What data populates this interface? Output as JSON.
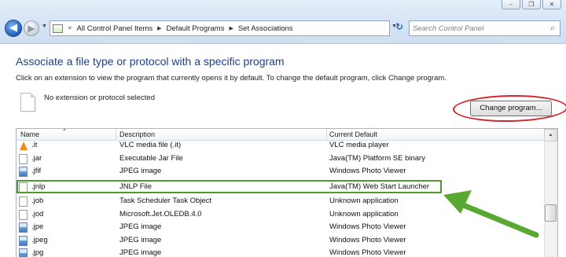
{
  "window": {
    "buttons": [
      "–",
      "❐",
      "✕"
    ]
  },
  "nav": {
    "back_glyph": "◀",
    "forward_glyph": "▶",
    "dropdown_glyph": "▼",
    "address_separator": "«",
    "breadcrumbs": [
      "All Control Panel Items",
      "Default Programs",
      "Set Associations"
    ],
    "crumb_separator": "▶",
    "refresh_glyph": "↻",
    "search_placeholder": "Search Control Panel"
  },
  "content": {
    "title": "Associate a file type or protocol with a specific program",
    "instructions": "Click on an extension to view the program that currently opens it by default. To change the default program, click Change program.",
    "selected_text": "No extension or protocol selected",
    "change_button": "Change program..."
  },
  "list": {
    "columns": [
      "Name",
      "Description",
      "Current Default"
    ],
    "rows": [
      {
        "name": ".it",
        "description": "VLC media file (.it)",
        "default": "VLC media player",
        "icon": "vlc-file-icon"
      },
      {
        "name": ".jar",
        "description": "Executable Jar File",
        "default": "Java(TM) Platform SE binary",
        "icon": "jar-file-icon"
      },
      {
        "name": ".jfif",
        "description": "JPEG image",
        "default": "Windows Photo Viewer",
        "icon": "image-file-icon"
      },
      {
        "name": ".jnlp",
        "description": "JNLP File",
        "default": "Java(TM) Web Start Launcher",
        "icon": "generic-file-icon"
      },
      {
        "name": ".job",
        "description": "Task Scheduler Task Object",
        "default": "Unknown application",
        "icon": "generic-file-icon"
      },
      {
        "name": ".jod",
        "description": "Microsoft.Jet.OLEDB.4.0",
        "default": "Unknown application",
        "icon": "generic-file-icon"
      },
      {
        "name": ".jpe",
        "description": "JPEG image",
        "default": "Windows Photo Viewer",
        "icon": "image-file-icon"
      },
      {
        "name": ".jpeg",
        "description": "JPEG image",
        "default": "Windows Photo Viewer",
        "icon": "image-file-icon"
      },
      {
        "name": ".jpg",
        "description": "JPEG image",
        "default": "Windows Photo Viewer",
        "icon": "image-file-icon"
      }
    ],
    "highlighted_row": ".jnlp"
  },
  "colors": {
    "title": "#1e3f8a",
    "highlight_green": "#4f9a2a",
    "annotation_red": "#d5232b"
  }
}
